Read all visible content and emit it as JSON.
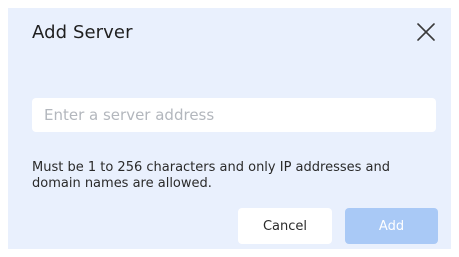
{
  "dialog": {
    "title": "Add Server",
    "input": {
      "value": "",
      "placeholder": "Enter a server address"
    },
    "hint": "Must be 1 to 256 characters and only IP addresses and domain names are allowed.",
    "buttons": {
      "cancel_label": "Cancel",
      "add_label": "Add"
    },
    "icons": {
      "close": "close-icon"
    },
    "colors": {
      "background": "#e9f0fd",
      "primary_disabled": "#a9c9f6"
    }
  }
}
